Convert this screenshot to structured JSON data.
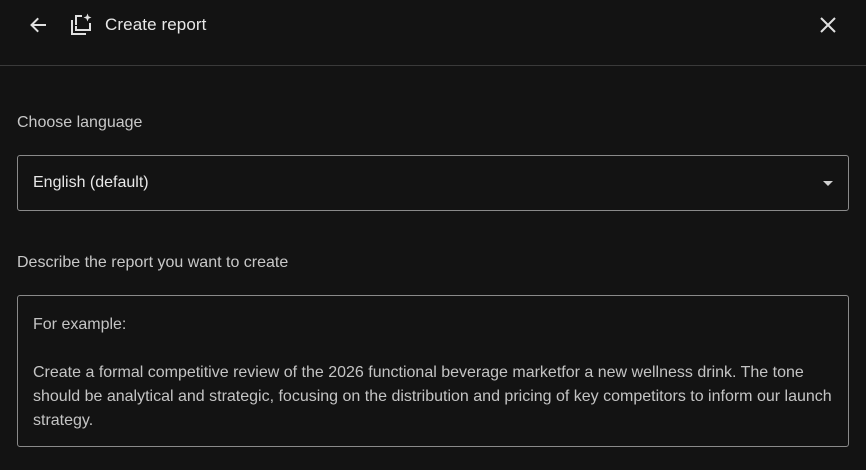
{
  "header": {
    "title": "Create report",
    "back_icon": "arrow-left-icon",
    "report_icon": "note-stack-add-icon",
    "close_icon": "close-icon"
  },
  "language": {
    "label": "Choose language",
    "selected": "English (default)"
  },
  "description": {
    "label": "Describe the report you want to create",
    "placeholder_intro": "For example:",
    "placeholder_example": "Create a formal competitive review of the 2026 functional beverage marketfor a new wellness drink. The tone should be analytical and strategic, focusing on the distribution and pricing of key competitors to inform our launch strategy."
  },
  "colors": {
    "background": "#131313",
    "text": "#e3e3e3",
    "border": "#8a8a8a",
    "divider": "#3a3a3a"
  }
}
